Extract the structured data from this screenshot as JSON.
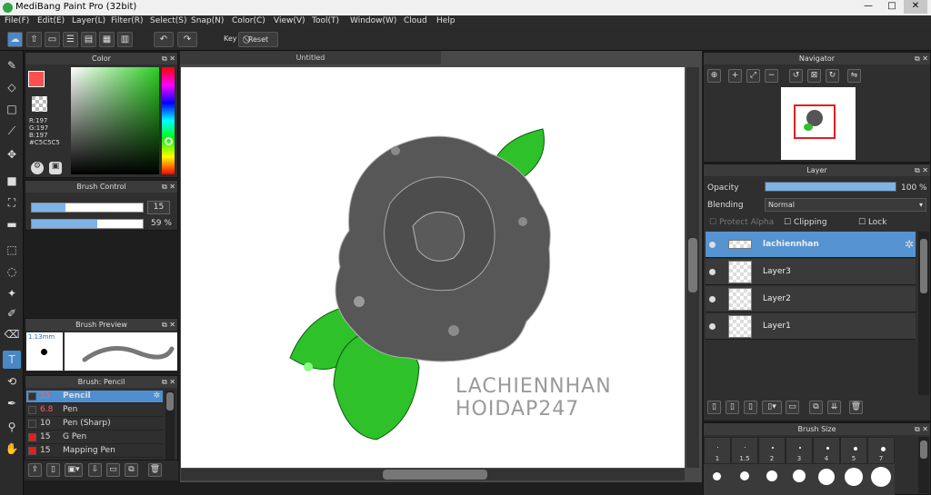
{
  "window": {
    "title": "MediBang Paint Pro (32bit)",
    "min": "—",
    "max": "□",
    "close": "✕"
  },
  "menu": [
    "File(F)",
    "Edit(E)",
    "Layer(L)",
    "Filter(R)",
    "Select(S)",
    "Snap(N)",
    "Color(C)",
    "View(V)",
    "Tool(T)",
    "Window(W)",
    "Cloud",
    "Help"
  ],
  "toolbar": {
    "key_label": "Key",
    "reset_label": "Reset"
  },
  "canvas": {
    "tab_title": "Untitled",
    "watermark_line1": "LACHIENNHAN",
    "watermark_line2": "HOIDAP247"
  },
  "color_panel": {
    "title": "Color",
    "r": "R:197",
    "g": "G:197",
    "b": "B:197",
    "hex": "#C5C5C5"
  },
  "brush_control": {
    "title": "Brush Control",
    "size": "15",
    "opacity": "59 %",
    "size_fill": 0.3,
    "opacity_fill": 0.59
  },
  "brush_preview": {
    "title": "Brush Preview",
    "size": "1.13mm"
  },
  "brush_list": {
    "title": "Brush: Pencil",
    "items": [
      {
        "size": "15",
        "name": "Pencil",
        "color": "#333333"
      },
      {
        "size": "6.8",
        "name": "Pen",
        "color": "#333333"
      },
      {
        "size": "10",
        "name": "Pen (Sharp)",
        "color": "#333333"
      },
      {
        "size": "15",
        "name": "G Pen",
        "color": "#e02020"
      },
      {
        "size": "15",
        "name": "Mapping Pen",
        "color": "#e02020"
      }
    ]
  },
  "navigator": {
    "title": "Navigator"
  },
  "layer_panel": {
    "title": "Layer",
    "opacity_label": "Opacity",
    "opacity_value": "100 %",
    "opacity_fill": 1.0,
    "blending_label": "Blending",
    "blending_value": "Normal",
    "protect_alpha": "Protect Alpha",
    "clipping": "Clipping",
    "lock": "Lock",
    "layers": [
      "lachiennhan",
      "Layer3",
      "Layer2",
      "Layer1"
    ]
  },
  "brush_size": {
    "title": "Brush Size",
    "sizes": [
      "1",
      "1.5",
      "2",
      "3",
      "4",
      "5",
      "7"
    ]
  }
}
